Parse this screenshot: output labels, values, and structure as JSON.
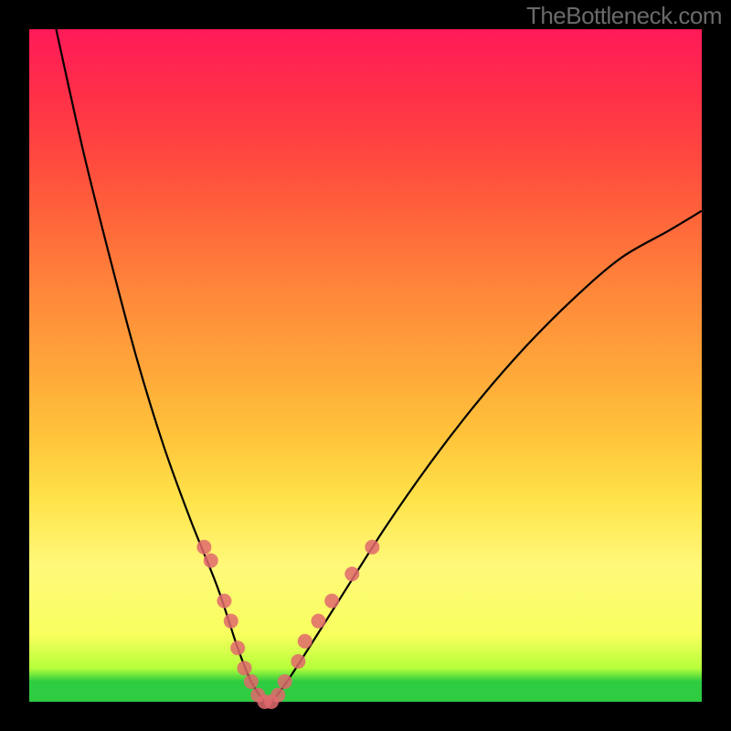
{
  "watermark": "TheBottleneck.com",
  "chart_data": {
    "type": "line",
    "title": "",
    "xlabel": "",
    "ylabel": "",
    "xlim": [
      0,
      100
    ],
    "ylim": [
      0,
      100
    ],
    "grid": false,
    "series": [
      {
        "name": "bottleneck-curve",
        "x": [
          4,
          8,
          12,
          16,
          20,
          24,
          28,
          31,
          33,
          35,
          36,
          39,
          46,
          53,
          60,
          67,
          74,
          81,
          88,
          95,
          100
        ],
        "y": [
          100,
          82,
          66,
          51,
          38,
          27,
          17,
          8,
          3,
          0,
          0,
          4,
          15,
          26,
          36,
          45,
          53,
          60,
          66,
          70,
          73
        ]
      }
    ],
    "highlight_points": {
      "name": "fit-points",
      "x": [
        26,
        27,
        29,
        30,
        31,
        32,
        33,
        34,
        35,
        36,
        37,
        38,
        40,
        41,
        43,
        45,
        48,
        51
      ],
      "y": [
        23,
        21,
        15,
        12,
        8,
        5,
        3,
        1,
        0,
        0,
        1,
        3,
        6,
        9,
        12,
        15,
        19,
        23
      ]
    },
    "background_gradient": {
      "bottom": "#2ecc40",
      "lower_mid": "#f8ff5e",
      "mid": "#ffc23a",
      "upper_mid": "#ff6b3a",
      "top": "#ff1a58"
    }
  }
}
